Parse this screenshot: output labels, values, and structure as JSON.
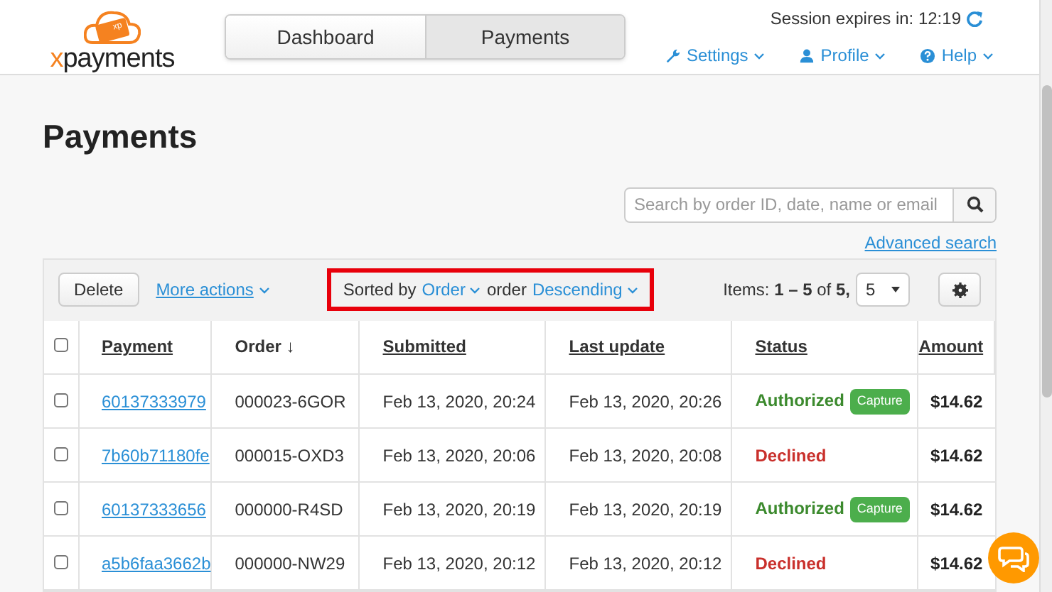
{
  "header": {
    "logo": "xpayments",
    "logo_badge": "xp",
    "nav_tabs": [
      {
        "label": "Dashboard",
        "selected": false
      },
      {
        "label": "Payments",
        "selected": true
      }
    ],
    "session": "Session expires in: 12:19",
    "menus": [
      {
        "label": "Settings",
        "kind": "settings"
      },
      {
        "label": "Profile",
        "kind": "profile"
      },
      {
        "label": "Help",
        "kind": "help"
      }
    ]
  },
  "page_title": "Payments",
  "search": {
    "placeholder": "Search by order ID, date, name or email"
  },
  "advanced_search": "Advanced search",
  "toolbar": {
    "delete": "Delete",
    "more_actions": "More actions",
    "sorted_by": "Sorted by",
    "sort_field": "Order",
    "order_label": "order",
    "sort_direction": "Descending",
    "items_prefix": "Items:",
    "items_range": "1 – 5",
    "items_of": "of",
    "items_total": "5,",
    "per_page": "5"
  },
  "table": {
    "select_all_checked": false,
    "columns": [
      "Payment",
      "Order ↓",
      "Submitted",
      "Last update",
      "Status",
      "Amount"
    ],
    "rows": [
      {
        "checked": false,
        "payment": "60137333979",
        "order": "000023-6GOR",
        "submitted": "Feb 13, 2020, 20:24",
        "last_update": "Feb 13, 2020, 20:26",
        "status": "Authorized",
        "kind": "authorized",
        "action": "Capture",
        "amount": "$14.62"
      },
      {
        "checked": false,
        "payment": "7b60b71180fe",
        "order": "000015-OXD3",
        "submitted": "Feb 13, 2020, 20:06",
        "last_update": "Feb 13, 2020, 20:08",
        "status": "Declined",
        "kind": "declined",
        "amount": "$14.62"
      },
      {
        "checked": false,
        "payment": "60137333656",
        "order": "000000-R4SD",
        "submitted": "Feb 13, 2020, 20:19",
        "last_update": "Feb 13, 2020, 20:19",
        "status": "Authorized",
        "kind": "authorized",
        "action": "Capture",
        "amount": "$14.62"
      },
      {
        "checked": false,
        "payment": "a5b6faa3662b",
        "order": "000000-NW29",
        "submitted": "Feb 13, 2020, 20:12",
        "last_update": "Feb 13, 2020, 20:12",
        "status": "Declined",
        "kind": "declined",
        "amount": "$14.62"
      }
    ]
  }
}
